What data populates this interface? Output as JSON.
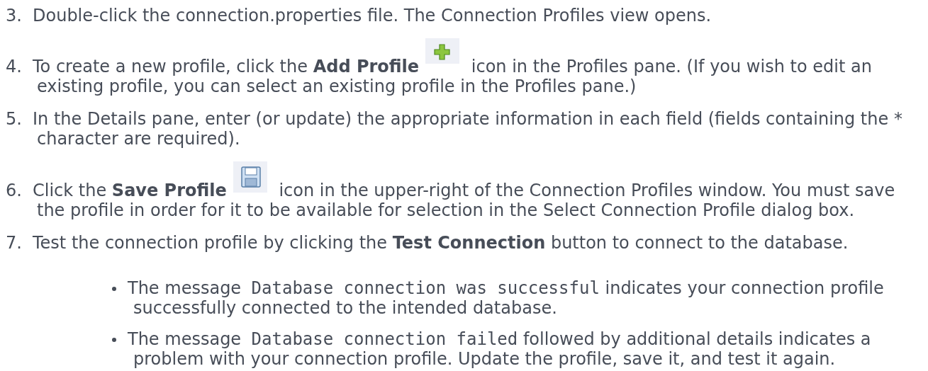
{
  "steps": [
    {
      "number": "3.",
      "parts": [
        {
          "kind": "text",
          "text": "Double-click the connection.properties file. The Connection Profiles view opens."
        }
      ]
    },
    {
      "number": "4.",
      "parts": [
        {
          "kind": "text",
          "text": "To create a new profile, click the **Add Profile**"
        },
        {
          "kind": "plus_icon"
        },
        {
          "kind": "text",
          "text": "icon in the Profiles pane. (If you wish to edit an existing profile, you can select an existing profile in the Profiles pane.)"
        }
      ]
    },
    {
      "number": "5.",
      "parts": [
        {
          "kind": "text",
          "text": "In the Details pane, enter (or update) the appropriate information in each field (fields containing the * character are required)."
        }
      ]
    },
    {
      "number": "6.",
      "parts": [
        {
          "kind": "text",
          "text": "Click the **Save Profile**"
        },
        {
          "kind": "floppy_icon"
        },
        {
          "kind": "text",
          "text": "icon in the upper-right of the Connection Profiles window.  You must save the profile in order for it to be available for selection in the Select Connection Profile dialog box."
        }
      ]
    },
    {
      "number": "7.",
      "parts": [
        {
          "kind": "text",
          "text": "Test the connection profile by clicking the **Test Connection** button to connect to the database."
        }
      ],
      "bullets": [
        {
          "parts": [
            {
              "kind": "text",
              "text": "The message"
            },
            {
              "kind": "code",
              "text": "Database connection was successful"
            },
            {
              "kind": "text",
              "text": "indicates your connection profile successfully connected to the intended database."
            }
          ]
        },
        {
          "parts": [
            {
              "kind": "text",
              "text": "The message"
            },
            {
              "kind": "code",
              "text": "Database connection failed"
            },
            {
              "kind": "text",
              "text": "followed by additional details indicates a problem with your connection profile. Update the profile, save it, and test it again."
            }
          ]
        }
      ]
    }
  ]
}
